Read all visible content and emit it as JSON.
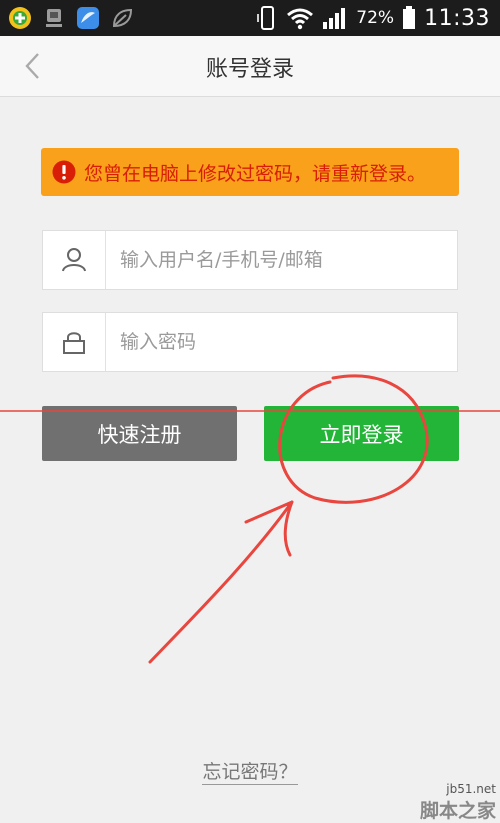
{
  "status_bar": {
    "battery_percent": "72%",
    "time": "11:33",
    "icons": [
      "app-360-icon",
      "app-gray-icon",
      "app-blue-icon",
      "leaf-icon",
      "vibrate-icon",
      "wifi-icon",
      "signal-icon",
      "battery-icon"
    ]
  },
  "header": {
    "title": "账号登录",
    "back_icon": "chevron-left-icon"
  },
  "alert": {
    "icon": "exclamation-icon",
    "text": "您曾在电脑上修改过密码，请重新登录。",
    "background": "#f9a11b",
    "text_color": "#d81e06"
  },
  "form": {
    "username": {
      "icon": "user-icon",
      "placeholder": "输入用户名/手机号/邮箱",
      "value": ""
    },
    "password": {
      "icon": "lock-icon",
      "placeholder": "输入密码",
      "value": ""
    }
  },
  "buttons": {
    "register_label": "快速注册",
    "register_color": "#707070",
    "login_label": "立即登录",
    "login_color": "#22b537"
  },
  "forgot_password": "忘记密码？",
  "annotation_color": "#e8463e",
  "watermark": {
    "site": "jb51.net",
    "name": "脚本之家"
  }
}
